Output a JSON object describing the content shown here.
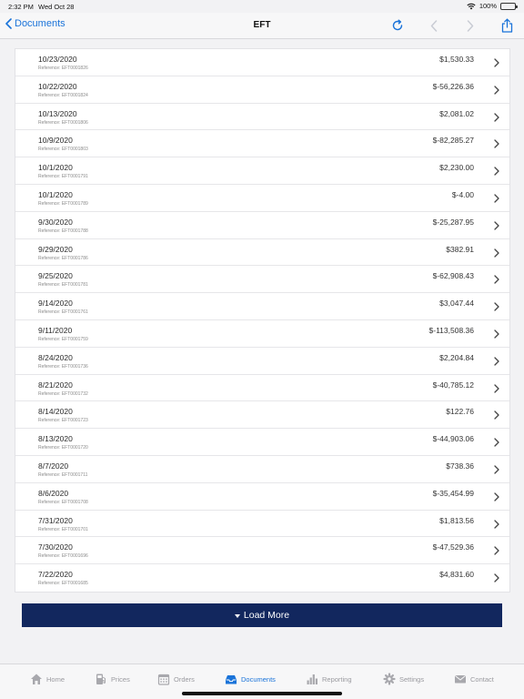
{
  "status": {
    "time": "2:32 PM",
    "date": "Wed Oct 28",
    "battery": "100%"
  },
  "nav": {
    "back_label": "Documents",
    "title": "EFT"
  },
  "rows": [
    {
      "date": "10/23/2020",
      "ref": "Reference: EFT0001826",
      "amount": "$1,530.33"
    },
    {
      "date": "10/22/2020",
      "ref": "Reference: EFT0001824",
      "amount": "$-56,226.36"
    },
    {
      "date": "10/13/2020",
      "ref": "Reference: EFT0001806",
      "amount": "$2,081.02"
    },
    {
      "date": "10/9/2020",
      "ref": "Reference: EFT0001803",
      "amount": "$-82,285.27"
    },
    {
      "date": "10/1/2020",
      "ref": "Reference: EFT0001791",
      "amount": "$2,230.00"
    },
    {
      "date": "10/1/2020",
      "ref": "Reference: EFT0001789",
      "amount": "$-4.00"
    },
    {
      "date": "9/30/2020",
      "ref": "Reference: EFT0001788",
      "amount": "$-25,287.95"
    },
    {
      "date": "9/29/2020",
      "ref": "Reference: EFT0001786",
      "amount": "$382.91"
    },
    {
      "date": "9/25/2020",
      "ref": "Reference: EFT0001781",
      "amount": "$-62,908.43"
    },
    {
      "date": "9/14/2020",
      "ref": "Reference: EFT0001761",
      "amount": "$3,047.44"
    },
    {
      "date": "9/11/2020",
      "ref": "Reference: EFT0001759",
      "amount": "$-113,508.36"
    },
    {
      "date": "8/24/2020",
      "ref": "Reference: EFT0001736",
      "amount": "$2,204.84"
    },
    {
      "date": "8/21/2020",
      "ref": "Reference: EFT0001732",
      "amount": "$-40,785.12"
    },
    {
      "date": "8/14/2020",
      "ref": "Reference: EFT0001723",
      "amount": "$122.76"
    },
    {
      "date": "8/13/2020",
      "ref": "Reference: EFT0001720",
      "amount": "$-44,903.06"
    },
    {
      "date": "8/7/2020",
      "ref": "Reference: EFT0001711",
      "amount": "$738.36"
    },
    {
      "date": "8/6/2020",
      "ref": "Reference: EFT0001708",
      "amount": "$-35,454.99"
    },
    {
      "date": "7/31/2020",
      "ref": "Reference: EFT0001701",
      "amount": "$1,813.56"
    },
    {
      "date": "7/30/2020",
      "ref": "Reference: EFT0001696",
      "amount": "$-47,529.36"
    },
    {
      "date": "7/22/2020",
      "ref": "Reference: EFT0001685",
      "amount": "$4,831.60"
    }
  ],
  "load_more_label": "Load More",
  "tabs": [
    {
      "label": "Home",
      "icon": "house-icon"
    },
    {
      "label": "Prices",
      "icon": "fuel-pump-icon"
    },
    {
      "label": "Orders",
      "icon": "calendar-icon"
    },
    {
      "label": "Documents",
      "icon": "inbox-icon",
      "active": true
    },
    {
      "label": "Reporting",
      "icon": "bar-chart-icon"
    },
    {
      "label": "Settings",
      "icon": "gear-icon"
    },
    {
      "label": "Contact",
      "icon": "envelope-icon"
    }
  ],
  "colors": {
    "accent": "#1a73d9",
    "button_bg": "#12275e",
    "tab_inactive": "#9a9a9f"
  }
}
